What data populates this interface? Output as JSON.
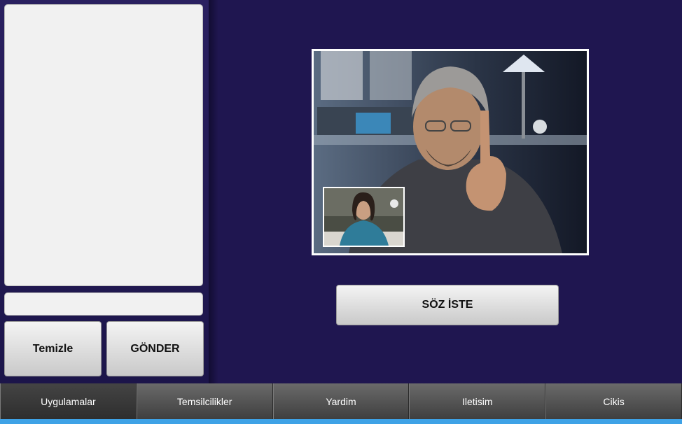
{
  "chat": {
    "log_text": "",
    "input_value": "",
    "clear_label": "Temizle",
    "send_label": "GÖNDER"
  },
  "video": {
    "request_label": "SÖZ İSTE"
  },
  "nav": {
    "items": [
      {
        "label": "Uygulamalar"
      },
      {
        "label": "Temsilcilikler"
      },
      {
        "label": "Yardim"
      },
      {
        "label": "Iletisim"
      },
      {
        "label": "Cikis"
      }
    ]
  },
  "colors": {
    "background": "#1f1650",
    "bottom_strip": "#3ea2e6"
  }
}
